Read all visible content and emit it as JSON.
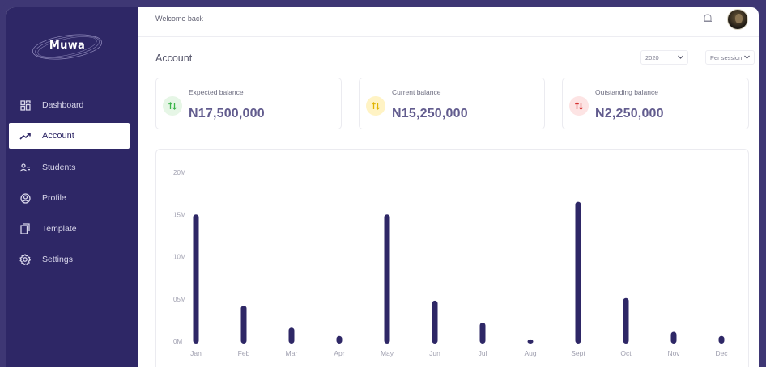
{
  "app": {
    "logo": "Muwa"
  },
  "sidebar": {
    "items": [
      {
        "label": "Dashboard",
        "icon": "dashboard-grid-icon",
        "active": false
      },
      {
        "label": "Account",
        "icon": "trending-up-icon",
        "active": true
      },
      {
        "label": "Students",
        "icon": "students-icon",
        "active": false
      },
      {
        "label": "Profile",
        "icon": "profile-icon",
        "active": false
      },
      {
        "label": "Template",
        "icon": "template-icon",
        "active": false
      },
      {
        "label": "Settings",
        "icon": "gear-icon",
        "active": false
      }
    ]
  },
  "header": {
    "welcome": "Welcome back"
  },
  "page": {
    "title": "Account",
    "year_select": "2020",
    "period_select": "Per session"
  },
  "cards": [
    {
      "label": "Expected balance",
      "value": "N17,500,000",
      "badge_color": "#e6f6e6",
      "arrow_color": "#3bb54a"
    },
    {
      "label": "Current balance",
      "value": "N15,250,000",
      "badge_color": "#fff3c4",
      "arrow_color": "#e0b400"
    },
    {
      "label": "Outstanding balance",
      "value": "N2,250,000",
      "badge_color": "#fde4e4",
      "arrow_color": "#d21f1f"
    }
  ],
  "colors": {
    "sidebar": "#2e2766",
    "frame": "#3e3774",
    "bar": "#2e2766",
    "accent_text": "#625c8e"
  },
  "chart_data": {
    "type": "bar",
    "categories": [
      "Jan",
      "Feb",
      "Mar",
      "Apr",
      "May",
      "Jun",
      "Jul",
      "Aug",
      "Sept",
      "Oct",
      "Nov",
      "Dec"
    ],
    "values": [
      15,
      4.2,
      1.6,
      0.6,
      15,
      4.8,
      2.2,
      0.2,
      16.5,
      5.1,
      1.1,
      0.6
    ],
    "ytick_labels": [
      "0M",
      "05M",
      "10M",
      "15M",
      "20M"
    ],
    "ytick_values": [
      0,
      5,
      10,
      15,
      20
    ],
    "ylim": [
      0,
      20
    ],
    "grid": false
  }
}
